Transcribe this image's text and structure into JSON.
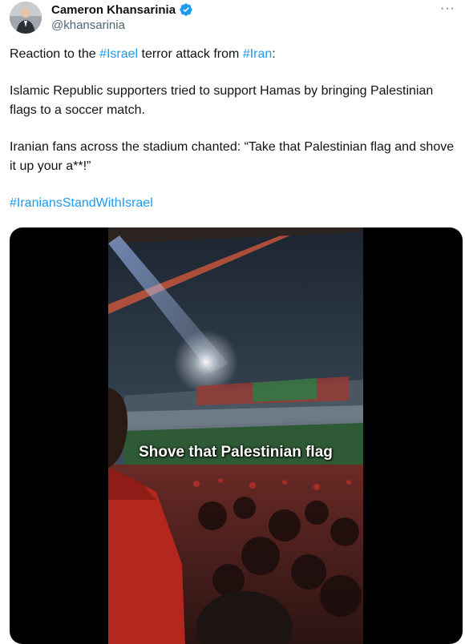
{
  "author": {
    "name": "Cameron Khansarinia",
    "handle": "@khansarinia",
    "verified": true,
    "avatar_icon": "profile-photo",
    "more_icon": "more-options-icon",
    "more_label": "···"
  },
  "tweet": {
    "line1_prefix": "Reaction to the ",
    "line1_tag1": "#Israel",
    "line1_middle": " terror attack from ",
    "line1_tag2": "#Iran",
    "line1_suffix": ":",
    "paragraph2": "Islamic Republic supporters tried to support Hamas by bringing Palestinian flags to a soccer match.",
    "paragraph3": "Iranian fans across the stadium chanted: “Take that Palestinian flag and shove it up your a**!”",
    "hashtag": "#IraniansStandWithIsrael"
  },
  "media": {
    "type": "video",
    "caption": "Shove that Palestinian flag"
  },
  "colors": {
    "link": "#1d9bf0",
    "verified": "#1d9bf0",
    "text": "#0f1419",
    "secondary": "#536471"
  }
}
